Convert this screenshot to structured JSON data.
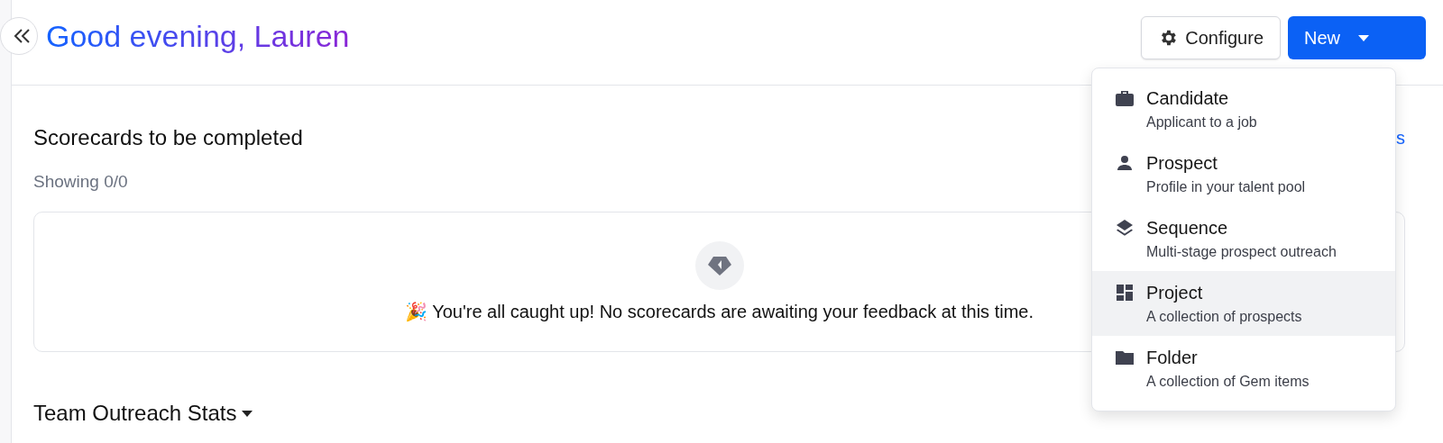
{
  "greeting": "Good evening, Lauren",
  "header_buttons": {
    "configure": "Configure",
    "new": "New"
  },
  "new_menu": [
    {
      "kind": "briefcase",
      "title": "Candidate",
      "description": "Applicant to a job",
      "selected": false
    },
    {
      "kind": "person",
      "title": "Prospect",
      "description": "Profile in your talent pool",
      "selected": false
    },
    {
      "kind": "layers",
      "title": "Sequence",
      "description": "Multi-stage prospect outreach",
      "selected": false
    },
    {
      "kind": "dashboard",
      "title": "Project",
      "description": "A collection of prospects",
      "selected": true
    },
    {
      "kind": "folder",
      "title": "Folder",
      "description": "A collection of Gem items",
      "selected": false
    }
  ],
  "scorecards": {
    "title": "Scorecards to be completed",
    "link": "s",
    "count": "Showing 0/0",
    "empty_message": "🎉 You're all caught up! No scorecards are awaiting your feedback at this time."
  },
  "team_outreach": {
    "title": "Team Outreach Stats"
  }
}
